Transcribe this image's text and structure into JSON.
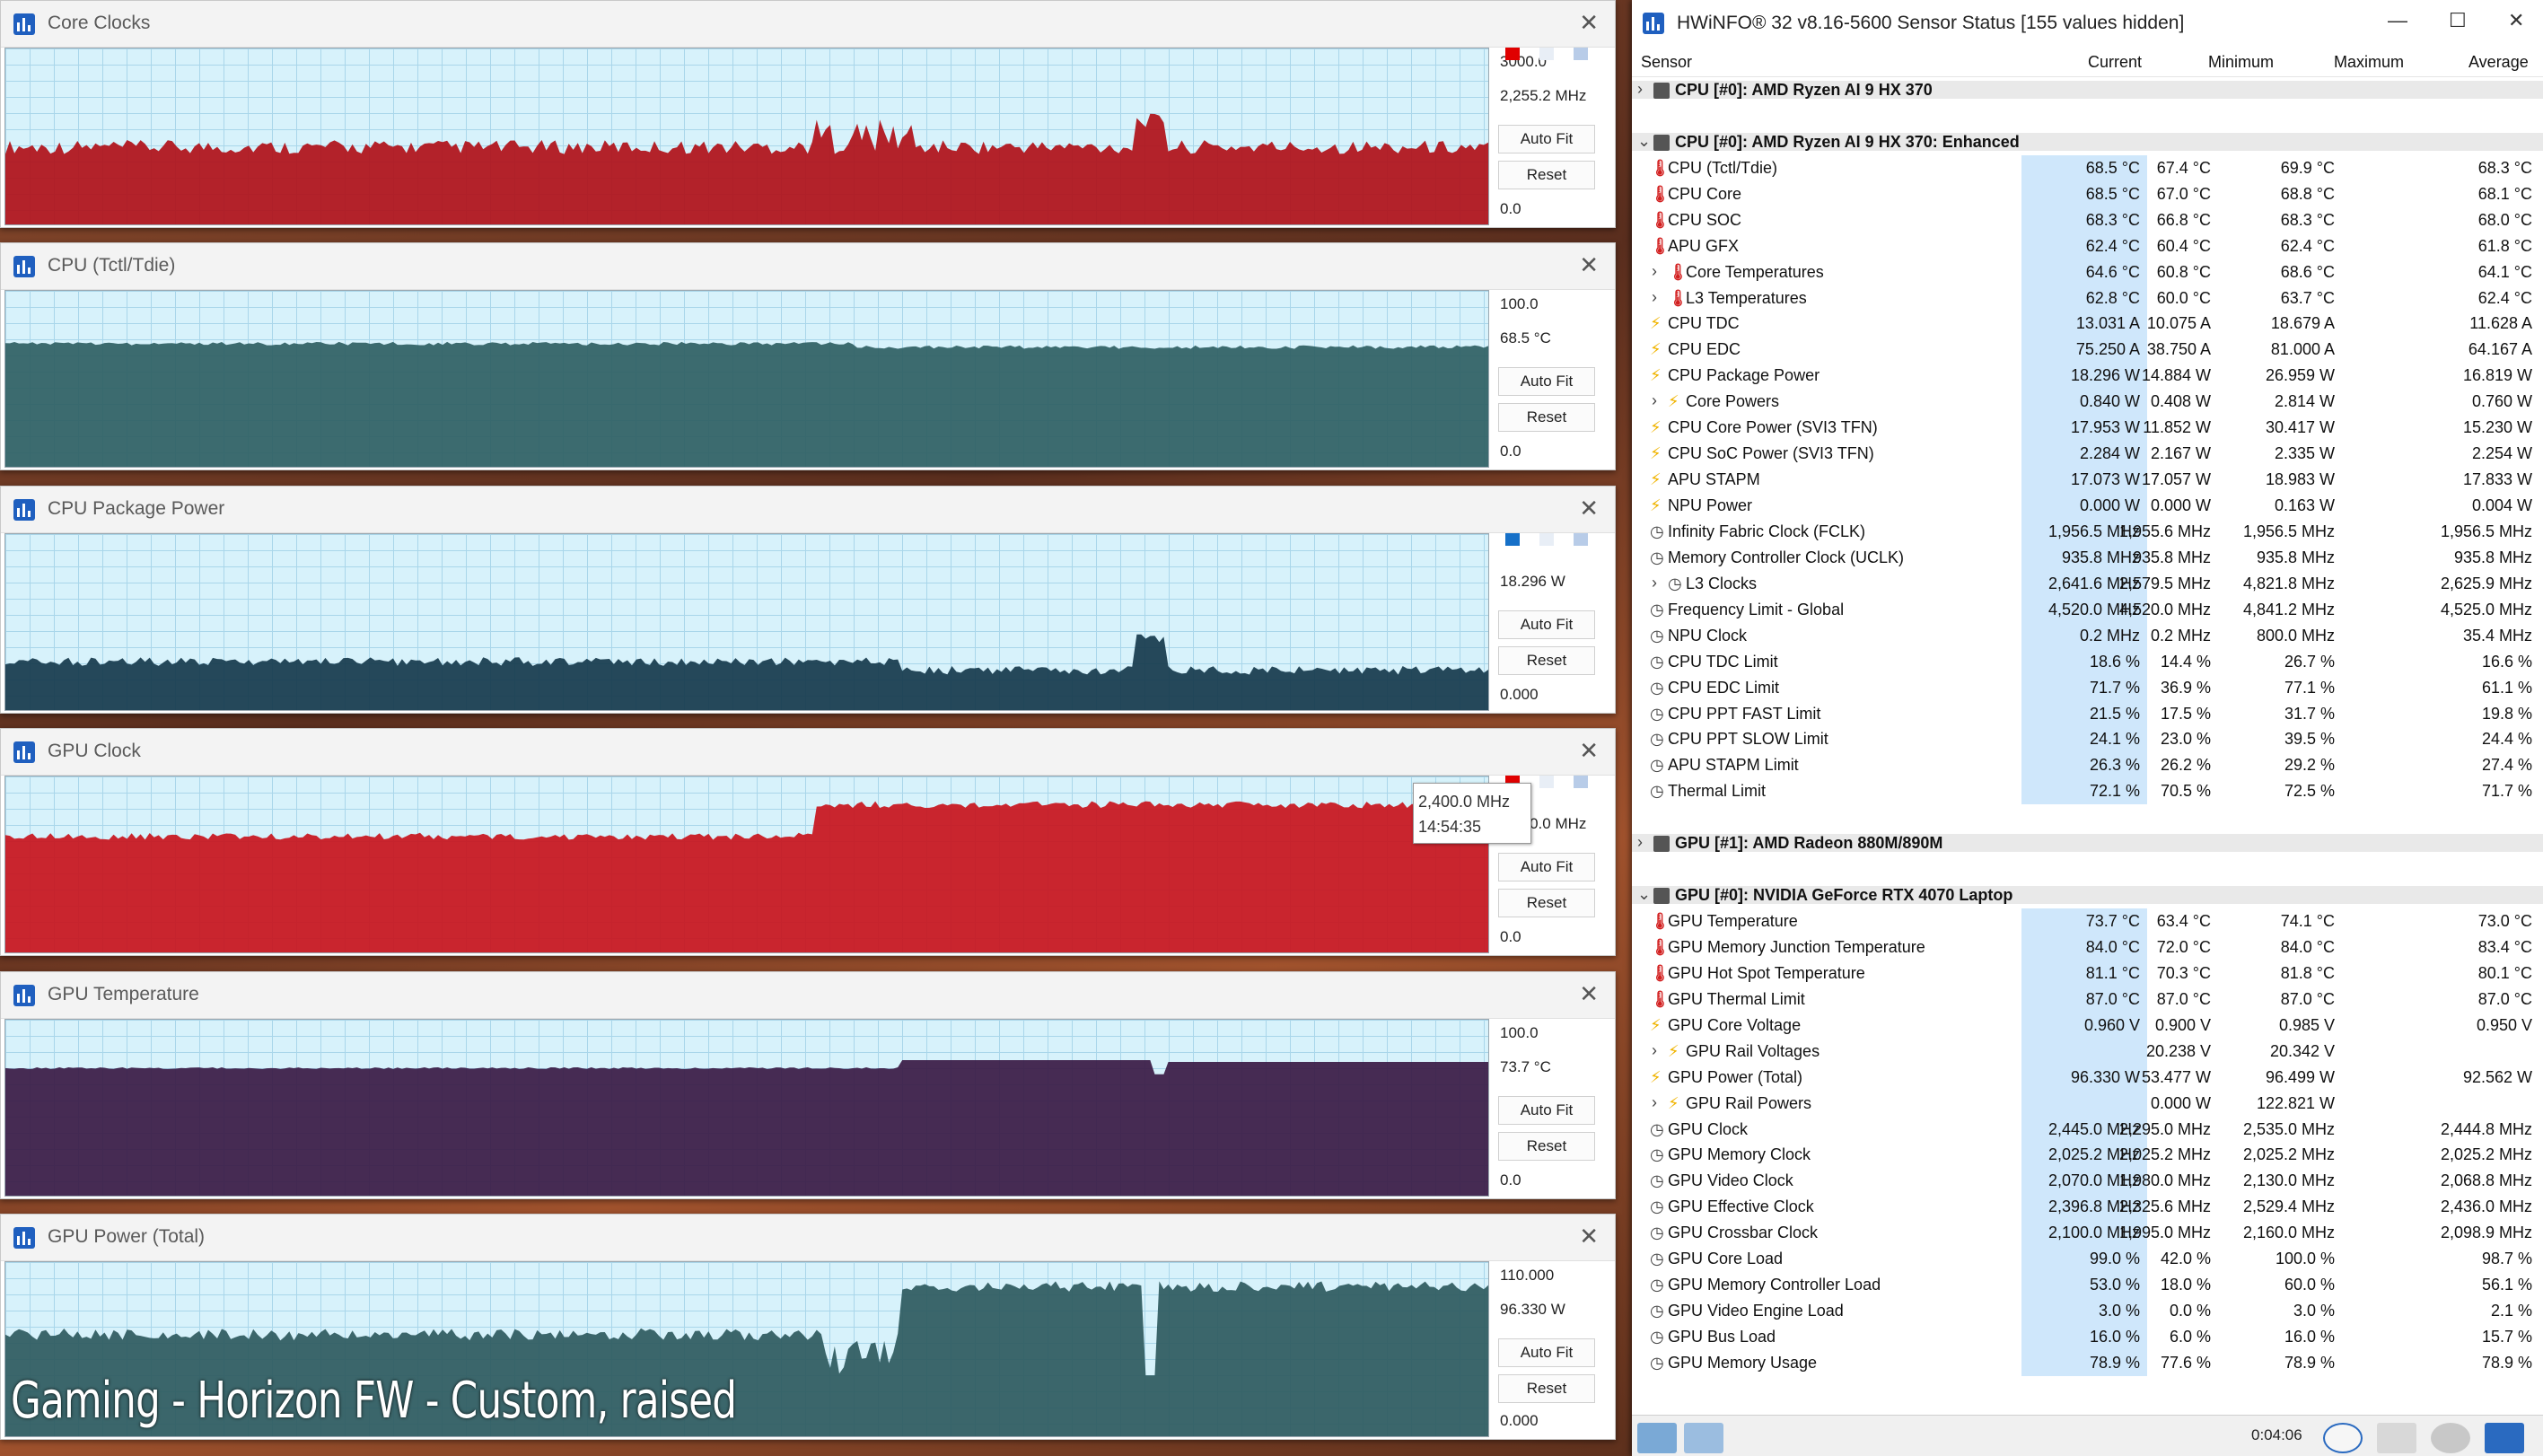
{
  "graph_windows": [
    {
      "title": "Core Clocks",
      "top_value": "3000.0",
      "current": "2,255.2 MHz",
      "bottom_value": "0.0",
      "auto_fit": "Auto Fit",
      "reset": "Reset",
      "color": "#b01018",
      "chips": [
        "#e00000",
        "#e8eef6",
        "#b8cce8"
      ]
    },
    {
      "title": "CPU (Tctl/Tdie)",
      "top_value": "100.0",
      "current": "68.5 °C",
      "bottom_value": "0.0",
      "auto_fit": "Auto Fit",
      "reset": "Reset",
      "color": "#2f5f63",
      "chips": []
    },
    {
      "title": "CPU Package Power",
      "top_value": "",
      "current": "18.296 W",
      "bottom_value": "0.000",
      "auto_fit": "Auto Fit",
      "reset": "Reset",
      "color": "#163a4c",
      "chips": [
        "#1670c8",
        "#e8eef6",
        "#b8cce8"
      ]
    },
    {
      "title": "GPU Clock",
      "top_value": "",
      "current": "2,400.0 MHz",
      "bottom_value": "0.0",
      "auto_fit": "Auto Fit",
      "reset": "Reset",
      "color": "#c8141c",
      "chips": [
        "#e00000",
        "#e8eef6",
        "#b8cce8"
      ]
    },
    {
      "title": "GPU Temperature",
      "top_value": "100.0",
      "current": "73.7 °C",
      "bottom_value": "0.0",
      "auto_fit": "Auto Fit",
      "reset": "Reset",
      "color": "#3a1a44",
      "chips": []
    },
    {
      "title": "GPU Power (Total)",
      "top_value": "110.000",
      "current": "96.330 W",
      "bottom_value": "0.000",
      "auto_fit": "Auto Fit",
      "reset": "Reset",
      "color": "#2e5a5e",
      "chips": []
    }
  ],
  "tooltip": {
    "value": "2,400.0 MHz",
    "time": "14:54:35"
  },
  "caption": "Gaming - Horizon FW - Custom, raised",
  "hwinfo": {
    "title": "HWiNFO® 32 v8.16-5600 Sensor Status [155 values hidden]",
    "minimize": "—",
    "maximize": "☐",
    "close": "✕",
    "columns": {
      "sensor": "Sensor",
      "current": "Current",
      "minimum": "Minimum",
      "maximum": "Maximum",
      "average": "Average"
    },
    "uptime": "0:04:06",
    "rows": [
      {
        "kind": "group",
        "label": "CPU [#0]: AMD Ryzen AI 9 HX 370",
        "expanded": false
      },
      {
        "kind": "blank"
      },
      {
        "kind": "group",
        "label": "CPU [#0]: AMD Ryzen AI 9 HX 370: Enhanced",
        "expanded": true
      },
      {
        "kind": "sensor",
        "icon": "temp",
        "label": "CPU (Tctl/Tdie)",
        "cur": "68.5 °C",
        "min": "67.4 °C",
        "max": "69.9 °C",
        "avg": "68.3 °C"
      },
      {
        "kind": "sensor",
        "icon": "temp",
        "label": "CPU Core",
        "cur": "68.5 °C",
        "min": "67.0 °C",
        "max": "68.8 °C",
        "avg": "68.1 °C"
      },
      {
        "kind": "sensor",
        "icon": "temp",
        "label": "CPU SOC",
        "cur": "68.3 °C",
        "min": "66.8 °C",
        "max": "68.3 °C",
        "avg": "68.0 °C"
      },
      {
        "kind": "sensor",
        "icon": "temp",
        "label": "APU GFX",
        "cur": "62.4 °C",
        "min": "60.4 °C",
        "max": "62.4 °C",
        "avg": "61.8 °C"
      },
      {
        "kind": "sensor",
        "icon": "temp",
        "label": "Core Temperatures",
        "sub": true,
        "cur": "64.6 °C",
        "min": "60.8 °C",
        "max": "68.6 °C",
        "avg": "64.1 °C"
      },
      {
        "kind": "sensor",
        "icon": "temp",
        "label": "L3 Temperatures",
        "sub": true,
        "cur": "62.8 °C",
        "min": "60.0 °C",
        "max": "63.7 °C",
        "avg": "62.4 °C"
      },
      {
        "kind": "sensor",
        "icon": "bolt",
        "label": "CPU TDC",
        "cur": "13.031 A",
        "min": "10.075 A",
        "max": "18.679 A",
        "avg": "11.628 A"
      },
      {
        "kind": "sensor",
        "icon": "bolt",
        "label": "CPU EDC",
        "cur": "75.250 A",
        "min": "38.750 A",
        "max": "81.000 A",
        "avg": "64.167 A"
      },
      {
        "kind": "sensor",
        "icon": "bolt",
        "label": "CPU Package Power",
        "cur": "18.296 W",
        "min": "14.884 W",
        "max": "26.959 W",
        "avg": "16.819 W"
      },
      {
        "kind": "sensor",
        "icon": "bolt",
        "label": "Core Powers",
        "sub": true,
        "cur": "0.840 W",
        "min": "0.408 W",
        "max": "2.814 W",
        "avg": "0.760 W"
      },
      {
        "kind": "sensor",
        "icon": "bolt",
        "label": "CPU Core Power (SVI3 TFN)",
        "cur": "17.953 W",
        "min": "11.852 W",
        "max": "30.417 W",
        "avg": "15.230 W"
      },
      {
        "kind": "sensor",
        "icon": "bolt",
        "label": "CPU SoC Power (SVI3 TFN)",
        "cur": "2.284 W",
        "min": "2.167 W",
        "max": "2.335 W",
        "avg": "2.254 W"
      },
      {
        "kind": "sensor",
        "icon": "bolt",
        "label": "APU STAPM",
        "cur": "17.073 W",
        "min": "17.057 W",
        "max": "18.983 W",
        "avg": "17.833 W"
      },
      {
        "kind": "sensor",
        "icon": "bolt",
        "label": "NPU Power",
        "cur": "0.000 W",
        "min": "0.000 W",
        "max": "0.163 W",
        "avg": "0.004 W"
      },
      {
        "kind": "sensor",
        "icon": "clock",
        "label": "Infinity Fabric Clock (FCLK)",
        "cur": "1,956.5 MHz",
        "min": "1,955.6 MHz",
        "max": "1,956.5 MHz",
        "avg": "1,956.5 MHz"
      },
      {
        "kind": "sensor",
        "icon": "clock",
        "label": "Memory Controller Clock (UCLK)",
        "cur": "935.8 MHz",
        "min": "935.8 MHz",
        "max": "935.8 MHz",
        "avg": "935.8 MHz"
      },
      {
        "kind": "sensor",
        "icon": "clock",
        "label": "L3 Clocks",
        "sub": true,
        "cur": "2,641.6 MHz",
        "min": "2,579.5 MHz",
        "max": "4,821.8 MHz",
        "avg": "2,625.9 MHz"
      },
      {
        "kind": "sensor",
        "icon": "clock",
        "label": "Frequency Limit - Global",
        "cur": "4,520.0 MHz",
        "min": "4,520.0 MHz",
        "max": "4,841.2 MHz",
        "avg": "4,525.0 MHz"
      },
      {
        "kind": "sensor",
        "icon": "clock",
        "label": "NPU Clock",
        "cur": "0.2 MHz",
        "min": "0.2 MHz",
        "max": "800.0 MHz",
        "avg": "35.4 MHz"
      },
      {
        "kind": "sensor",
        "icon": "pct",
        "label": "CPU TDC Limit",
        "cur": "18.6 %",
        "min": "14.4 %",
        "max": "26.7 %",
        "avg": "16.6 %"
      },
      {
        "kind": "sensor",
        "icon": "pct",
        "label": "CPU EDC Limit",
        "cur": "71.7 %",
        "min": "36.9 %",
        "max": "77.1 %",
        "avg": "61.1 %"
      },
      {
        "kind": "sensor",
        "icon": "pct",
        "label": "CPU PPT FAST Limit",
        "cur": "21.5 %",
        "min": "17.5 %",
        "max": "31.7 %",
        "avg": "19.8 %"
      },
      {
        "kind": "sensor",
        "icon": "pct",
        "label": "CPU PPT SLOW Limit",
        "cur": "24.1 %",
        "min": "23.0 %",
        "max": "39.5 %",
        "avg": "24.4 %"
      },
      {
        "kind": "sensor",
        "icon": "pct",
        "label": "APU STAPM Limit",
        "cur": "26.3 %",
        "min": "26.2 %",
        "max": "29.2 %",
        "avg": "27.4 %"
      },
      {
        "kind": "sensor",
        "icon": "pct",
        "label": "Thermal Limit",
        "cur": "72.1 %",
        "min": "70.5 %",
        "max": "72.5 %",
        "avg": "71.7 %"
      },
      {
        "kind": "blank"
      },
      {
        "kind": "group",
        "label": "GPU [#1]: AMD Radeon 880M/890M",
        "expanded": false
      },
      {
        "kind": "blank"
      },
      {
        "kind": "group",
        "label": "GPU [#0]: NVIDIA GeForce RTX 4070 Laptop",
        "expanded": true
      },
      {
        "kind": "sensor",
        "icon": "temp",
        "label": "GPU Temperature",
        "cur": "73.7 °C",
        "min": "63.4 °C",
        "max": "74.1 °C",
        "avg": "73.0 °C"
      },
      {
        "kind": "sensor",
        "icon": "temp",
        "label": "GPU Memory Junction Temperature",
        "cur": "84.0 °C",
        "min": "72.0 °C",
        "max": "84.0 °C",
        "avg": "83.4 °C"
      },
      {
        "kind": "sensor",
        "icon": "temp",
        "label": "GPU Hot Spot Temperature",
        "cur": "81.1 °C",
        "min": "70.3 °C",
        "max": "81.8 °C",
        "avg": "80.1 °C"
      },
      {
        "kind": "sensor",
        "icon": "temp",
        "label": "GPU Thermal Limit",
        "cur": "87.0 °C",
        "min": "87.0 °C",
        "max": "87.0 °C",
        "avg": "87.0 °C"
      },
      {
        "kind": "sensor",
        "icon": "bolt",
        "label": "GPU Core Voltage",
        "cur": "0.960 V",
        "min": "0.900 V",
        "max": "0.985 V",
        "avg": "0.950 V"
      },
      {
        "kind": "sensor",
        "icon": "bolt",
        "label": "GPU Rail Voltages",
        "sub": true,
        "cur": "",
        "min": "20.238 V",
        "max": "20.342 V",
        "avg": ""
      },
      {
        "kind": "sensor",
        "icon": "bolt",
        "label": "GPU Power (Total)",
        "cur": "96.330 W",
        "min": "53.477 W",
        "max": "96.499 W",
        "avg": "92.562 W"
      },
      {
        "kind": "sensor",
        "icon": "bolt",
        "label": "GPU Rail Powers",
        "sub": true,
        "cur": "",
        "min": "0.000 W",
        "max": "122.821 W",
        "avg": ""
      },
      {
        "kind": "sensor",
        "icon": "clock",
        "label": "GPU Clock",
        "cur": "2,445.0 MHz",
        "min": "2,295.0 MHz",
        "max": "2,535.0 MHz",
        "avg": "2,444.8 MHz"
      },
      {
        "kind": "sensor",
        "icon": "clock",
        "label": "GPU Memory Clock",
        "cur": "2,025.2 MHz",
        "min": "2,025.2 MHz",
        "max": "2,025.2 MHz",
        "avg": "2,025.2 MHz"
      },
      {
        "kind": "sensor",
        "icon": "clock",
        "label": "GPU Video Clock",
        "cur": "2,070.0 MHz",
        "min": "1,980.0 MHz",
        "max": "2,130.0 MHz",
        "avg": "2,068.8 MHz"
      },
      {
        "kind": "sensor",
        "icon": "clock",
        "label": "GPU Effective Clock",
        "cur": "2,396.8 MHz",
        "min": "2,325.6 MHz",
        "max": "2,529.4 MHz",
        "avg": "2,436.0 MHz"
      },
      {
        "kind": "sensor",
        "icon": "clock",
        "label": "GPU Crossbar Clock",
        "cur": "2,100.0 MHz",
        "min": "1,995.0 MHz",
        "max": "2,160.0 MHz",
        "avg": "2,098.9 MHz"
      },
      {
        "kind": "sensor",
        "icon": "pct",
        "label": "GPU Core Load",
        "cur": "99.0 %",
        "min": "42.0 %",
        "max": "100.0 %",
        "avg": "98.7 %"
      },
      {
        "kind": "sensor",
        "icon": "pct",
        "label": "GPU Memory Controller Load",
        "cur": "53.0 %",
        "min": "18.0 %",
        "max": "60.0 %",
        "avg": "56.1 %"
      },
      {
        "kind": "sensor",
        "icon": "pct",
        "label": "GPU Video Engine Load",
        "cur": "3.0 %",
        "min": "0.0 %",
        "max": "3.0 %",
        "avg": "2.1 %"
      },
      {
        "kind": "sensor",
        "icon": "pct",
        "label": "GPU Bus Load",
        "cur": "16.0 %",
        "min": "6.0 %",
        "max": "16.0 %",
        "avg": "15.7 %"
      },
      {
        "kind": "sensor",
        "icon": "pct",
        "label": "GPU Memory Usage",
        "cur": "78.9 %",
        "min": "77.6 %",
        "max": "78.9 %",
        "avg": "78.9 %"
      }
    ]
  }
}
